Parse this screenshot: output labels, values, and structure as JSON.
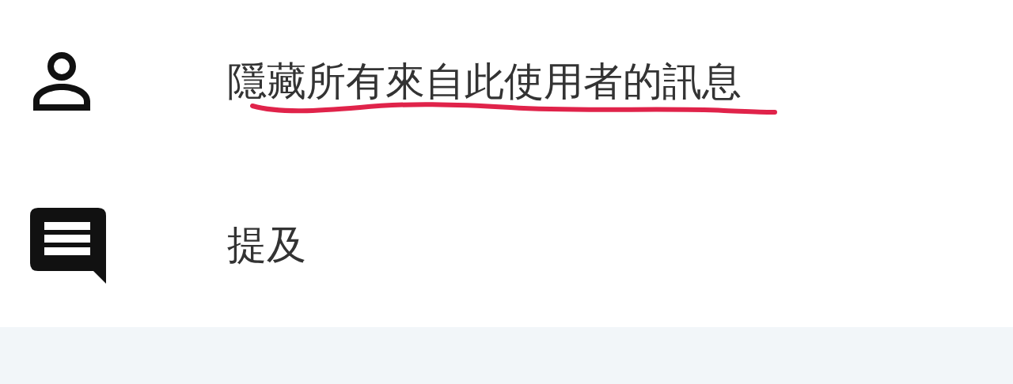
{
  "menu_items": [
    {
      "kind": "person",
      "label": "隱藏所有來自此使用者的訊息",
      "underlined": true
    },
    {
      "kind": "message",
      "label": "提及",
      "underlined": false
    }
  ]
}
